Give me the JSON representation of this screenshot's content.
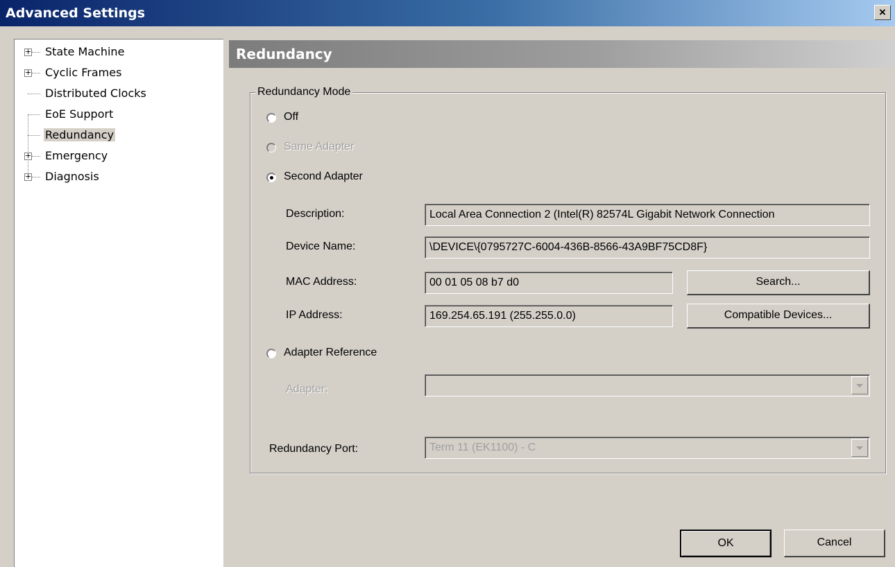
{
  "window": {
    "title": "Advanced Settings",
    "close_label": "×"
  },
  "tree": {
    "items": [
      {
        "label": "State Machine",
        "expandable": true
      },
      {
        "label": "Cyclic Frames",
        "expandable": true
      },
      {
        "label": "Distributed Clocks",
        "expandable": false
      },
      {
        "label": "EoE Support",
        "expandable": false
      },
      {
        "label": "Redundancy",
        "expandable": false,
        "selected": true
      },
      {
        "label": "Emergency",
        "expandable": true
      },
      {
        "label": "Diagnosis",
        "expandable": true
      }
    ],
    "expander_glyph": "+"
  },
  "section": {
    "title": "Redundancy"
  },
  "mode_group": {
    "legend": "Redundancy Mode",
    "options": {
      "off": {
        "label": "Off",
        "checked": false,
        "enabled": true
      },
      "same_adapter": {
        "label": "Same Adapter",
        "checked": false,
        "enabled": false
      },
      "second_adapter": {
        "label": "Second Adapter",
        "checked": true,
        "enabled": true
      },
      "adapter_reference": {
        "label": "Adapter Reference",
        "checked": false,
        "enabled": true
      }
    },
    "fields": {
      "description": {
        "label": "Description:",
        "value": "Local Area Connection 2 (Intel(R) 82574L Gigabit Network Connection"
      },
      "device_name": {
        "label": "Device Name:",
        "value": "\\DEVICE\\{0795727C-6004-436B-8566-43A9BF75CD8F}"
      },
      "mac_address": {
        "label": "MAC Address:",
        "value": "00 01 05 08 b7 d0"
      },
      "ip_address": {
        "label": "IP Address:",
        "value": "169.254.65.191 (255.255.0.0)"
      },
      "adapter": {
        "label": "Adapter:",
        "value": ""
      },
      "redundancy_port": {
        "label": "Redundancy Port:",
        "value": "Term 11 (EK1100) - C"
      }
    },
    "buttons": {
      "search": "Search...",
      "compatible_devices": "Compatible Devices..."
    }
  },
  "footer": {
    "ok": "OK",
    "cancel": "Cancel"
  }
}
